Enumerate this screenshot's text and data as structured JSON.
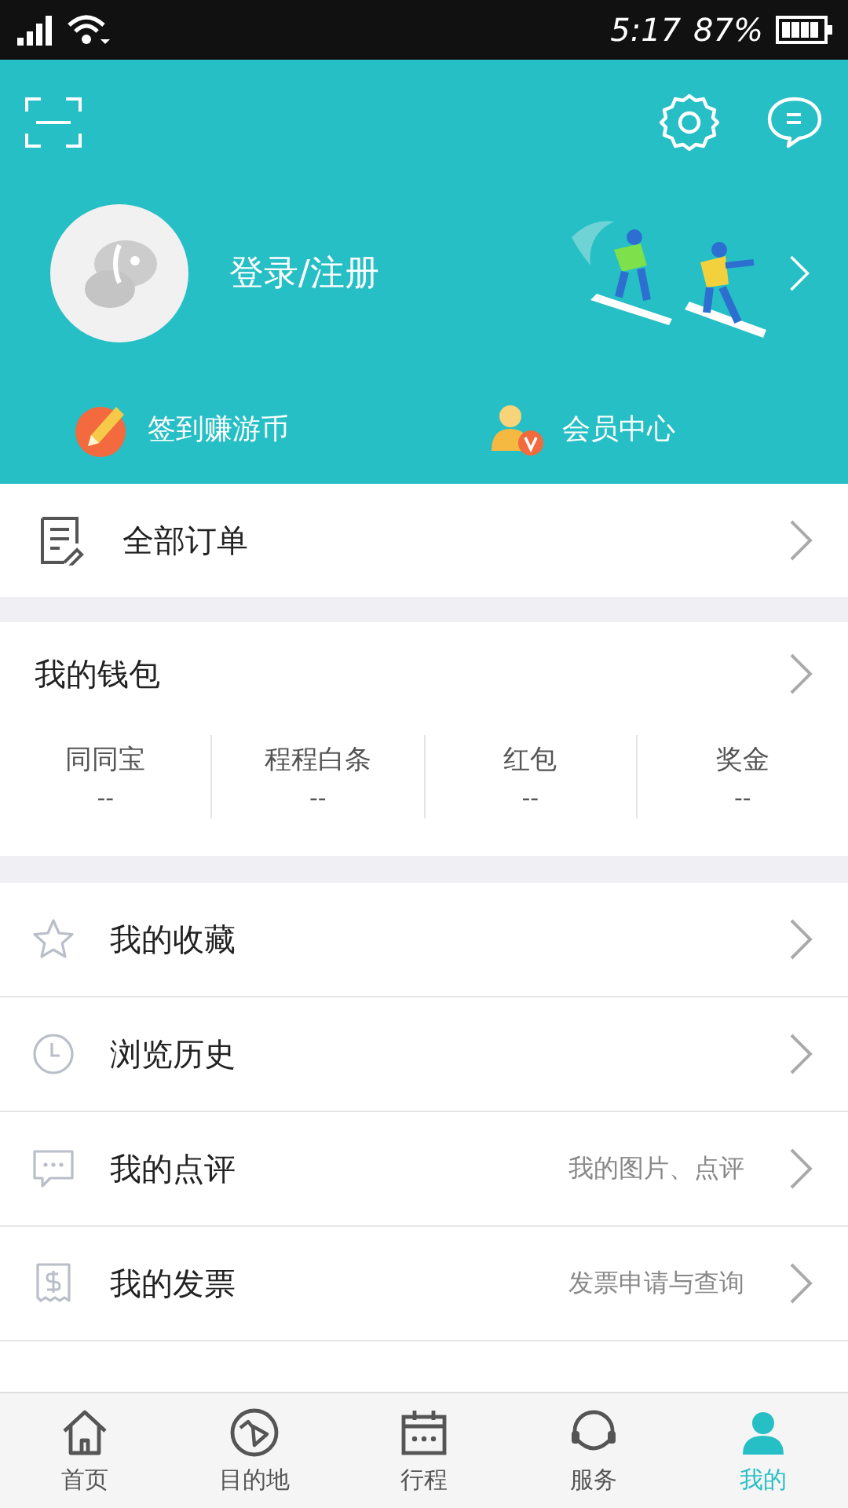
{
  "status_bar": {
    "time": "5:17",
    "battery": "87%"
  },
  "profile": {
    "login": "登录/注册"
  },
  "quick_links": [
    {
      "kind": "checkin",
      "label": "签到赚游币"
    },
    {
      "kind": "member",
      "label": "会员中心"
    }
  ],
  "orders": {
    "label": "全部订单"
  },
  "wallet": {
    "title": "我的钱包",
    "items": [
      {
        "label": "同同宝",
        "value": "--"
      },
      {
        "label": "程程白条",
        "value": "--"
      },
      {
        "label": "红包",
        "value": "--"
      },
      {
        "label": "奖金",
        "value": "--"
      }
    ]
  },
  "menu": [
    {
      "kind": "star",
      "label": "我的收藏"
    },
    {
      "kind": "clock",
      "label": "浏览历史"
    },
    {
      "kind": "comment",
      "label": "我的点评",
      "hint": "我的图片、点评"
    },
    {
      "kind": "invoice",
      "label": "我的发票",
      "hint": "发票申请与查询"
    }
  ],
  "tabs": [
    {
      "kind": "home",
      "label": "首页",
      "selected": false
    },
    {
      "kind": "destination",
      "label": "目的地",
      "selected": false
    },
    {
      "kind": "trip",
      "label": "行程",
      "selected": false
    },
    {
      "kind": "service",
      "label": "服务",
      "selected": false
    },
    {
      "kind": "me",
      "label": "我的",
      "selected": true
    }
  ]
}
